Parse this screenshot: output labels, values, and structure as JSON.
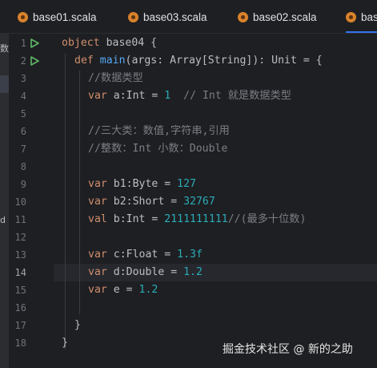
{
  "tabs": [
    {
      "label": "base01.scala",
      "active": false
    },
    {
      "label": "base03.scala",
      "active": false
    },
    {
      "label": "base02.scala",
      "active": false
    },
    {
      "label": "bas",
      "active": true
    }
  ],
  "left_panel": {
    "fragment_top": "数",
    "fragment_bottom": "d"
  },
  "line_numbers": [
    "1",
    "2",
    "3",
    "4",
    "5",
    "6",
    "7",
    "8",
    "9",
    "10",
    "11",
    "12",
    "13",
    "14",
    "15",
    "16",
    "17",
    "18"
  ],
  "current_line": "14",
  "run_icons": "run-gutter-icon",
  "code": {
    "l1": {
      "kw": "object",
      "rest": " base04 {"
    },
    "l2": {
      "kw": "def",
      "fn": "main",
      "rest": "(args: Array[String]): Unit = {"
    },
    "l3": {
      "comment": "//数据类型"
    },
    "l4": {
      "kw": "var",
      "name": " a:Int = ",
      "num": "1",
      "comment": "  // Int 就是数据类型"
    },
    "l6": {
      "comment": "//三大类：数值,字符串,引用"
    },
    "l7": {
      "comment": "//整数：Int 小数：Double"
    },
    "l9": {
      "kw": "var",
      "name": " b1:Byte = ",
      "num": "127"
    },
    "l10": {
      "kw": "var",
      "name": " b2:Short = ",
      "num": "32767"
    },
    "l11": {
      "kw": "val",
      "name": " b:Int = ",
      "num": "2111111111",
      "comment": "//(最多十位数)"
    },
    "l13": {
      "kw": "var",
      "name": " c:Float = ",
      "num": "1.3f"
    },
    "l14": {
      "kw": "var",
      "name": " d:Double = ",
      "num": "1.2"
    },
    "l15": {
      "kw": "var",
      "name": " e = ",
      "num": "1.2"
    },
    "l17": {
      "text": "}"
    },
    "l18": {
      "text": "}"
    }
  },
  "watermark": "掘金技术社区 @ 新的之助",
  "colors": {
    "background": "#1e1f22",
    "keyword": "#cf8e6d",
    "function": "#56a8f5",
    "number": "#2aacb8",
    "comment": "#7a7e85",
    "tab_accent": "#3574f0",
    "run_icon": "#5fb865"
  }
}
